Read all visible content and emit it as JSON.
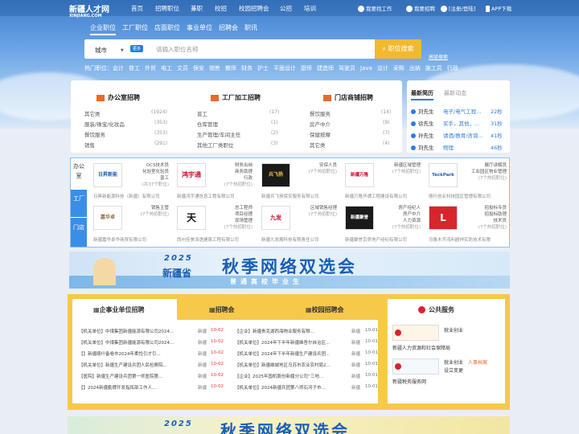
{
  "topnav": {
    "logo": "新疆人才网",
    "logo_sub": "XINJIANG.COM",
    "items": [
      "首页",
      "招聘职位",
      "兼职",
      "校招",
      "校园招聘会",
      "公招",
      "培训"
    ],
    "right": [
      "我要找工作",
      "我要招聘",
      "[注册/登陆]",
      "APP下载"
    ]
  },
  "search": {
    "tabs": [
      "企业职位",
      "工厂职位",
      "店面职位",
      "事业单位",
      "招聘会",
      "职讯"
    ],
    "city": "城市",
    "badge": "更多",
    "placeholder": "请输入职位名称",
    "button": "职位搜索",
    "advanced": "高级搜索"
  },
  "hot": {
    "label": "热门职位：",
    "items": [
      "会计",
      "普工",
      "外贸",
      "电工",
      "文员",
      "保安",
      "销售",
      "教师",
      "财务",
      "护士",
      "平面设计",
      "厨师",
      "建造师",
      "驾驶员",
      "Java",
      "设计",
      "采购",
      "出纳",
      "施工员",
      "行政"
    ]
  },
  "categories": [
    {
      "title": "办公室招聘",
      "icon": "briefcase-icon",
      "rows": [
        [
          "其它类",
          "(1924)"
        ],
        [
          "服装/珠宝/化妆品",
          "(353)"
        ],
        [
          "餐饮服务",
          "(353)"
        ],
        [
          "销售",
          "(291)"
        ]
      ]
    },
    {
      "title": "工厂加工招聘",
      "icon": "factory-icon",
      "rows": [
        [
          "普工",
          "(17)"
        ],
        [
          "仓库管理",
          "(1)"
        ],
        [
          "生产管理/车间主任",
          "(2)"
        ],
        [
          "其他工厂类职位",
          "(3)"
        ]
      ]
    },
    {
      "title": "门店商铺招聘",
      "icon": "store-icon",
      "rows": [
        [
          "餐饮服务",
          "(14)"
        ],
        [
          "房产中介",
          "(9)"
        ],
        [
          "保健按摩",
          "(7)"
        ],
        [
          "其它类",
          "(4)"
        ]
      ]
    }
  ],
  "resumes": {
    "tabs": [
      "最新简历",
      "最新动态"
    ],
    "rows": [
      [
        "刘先生",
        "电子/电气工程...",
        "22秒"
      ],
      [
        "徐先生",
        "买手，其他，...",
        "31秒"
      ],
      [
        "孙先生",
        "请酒/教育/咨询...",
        "41秒"
      ],
      [
        "刘先生",
        "物理",
        "46秒"
      ]
    ]
  },
  "companies": {
    "sidebar": [
      "办公室",
      "工厂",
      "门店"
    ],
    "items": [
      {
        "logo": "日昇新能",
        "jobs": [
          "DCS技术员",
          "化验室化验员",
          "普工"
        ],
        "more": "(共37个职位)",
        "name": "日昇新能源科技（新疆）有限公司"
      },
      {
        "logo": "鸿宇通",
        "jobs": [
          "财务出纳",
          "商务助理",
          "行政"
        ],
        "more": "(7个热招职位)",
        "name": "新疆鸿宇通信息工程有限公司"
      },
      {
        "logo": "兵飞扬",
        "jobs": [
          "安保人员"
        ],
        "more": "(7个热招职位)",
        "name": "新疆兵飞扬保安服务有限公司"
      },
      {
        "logo": "新疆万隆",
        "jobs": [
          "新疆区域管理"
        ],
        "more": "(7个热招职位)",
        "name": "新疆万隆华通工程建设有限公司"
      },
      {
        "logo": "TeckPark",
        "jobs": [
          "展厅讲解员",
          "工业园区物业管理"
        ],
        "more": "(7个热招职位)",
        "name": "喀什创业科技园区管理有限公司"
      },
      {
        "logo": "嘉华卓",
        "jobs": [
          "销售主管"
        ],
        "more": "(7个热招职位)",
        "name": "新疆嘉华卓华商贸有限公司"
      },
      {
        "logo": "天",
        "jobs": [
          "总工程师",
          "项目经理",
          "现场管理"
        ],
        "more": "(7个热招职位)",
        "name": "西州佳美泽透建筑工程有限公司"
      },
      {
        "logo": "九发",
        "jobs": [
          "区域销售经理"
        ],
        "more": "(7个热招职位)",
        "name": "新疆九发展科技有限责任公司"
      },
      {
        "logo": "新疆聚誉",
        "jobs": [
          "房产经纪人",
          "房产中介",
          "人力资源"
        ],
        "more": "(7个热招职位)",
        "name": "新疆聚誉京房地产经纪有限公司"
      },
      {
        "logo": "L",
        "jobs": [
          "招投标专员",
          "招投标助理",
          "技术员"
        ],
        "more": "(7个热招职位)",
        "name": "乌鲁木齐鸿利超祥实防技术有限"
      }
    ]
  },
  "banner": {
    "year": "2025",
    "province": "新疆省",
    "main": "秋季网络双选会",
    "sub": "普通高校毕业生"
  },
  "jobs_panel": {
    "tabs": [
      "企事业单位招聘",
      "招聘会",
      "校园招聘会"
    ],
    "left": [
      [
        "【机关单位】中煤集团新疆能源有限公司2024...",
        "新疆",
        "10-02"
      ],
      [
        "【机关单位】中煤集团新疆能源有限公司2024...",
        "新疆",
        "10-02"
      ],
      [
        "【】新疆喀什备卷市2024年柔性引才引...",
        "新疆",
        "10-02"
      ],
      [
        "【机关单位】新疆生产建设兵团人民检察院...",
        "新疆",
        "10-02"
      ],
      [
        "【医院】新疆生产建设兵团第一师医院第...",
        "新疆",
        "10-02"
      ],
      [
        "【】2024新疆勤牌开发指挥部工作人...",
        "新疆",
        "10-02"
      ]
    ],
    "right": [
      [
        "【企业】新疆贵克湖西海物业服务有限...",
        "新疆",
        "10-01"
      ],
      [
        "【机关单位】2024年下半年新疆维吾尔自治区...",
        "新疆",
        "10-01"
      ],
      [
        "【机关单位】2024年下半年新疆生产建设兵团...",
        "新疆",
        "10-01"
      ],
      [
        "【机关单位】新疆维城地区乌苏市农业农村局2...",
        "新疆",
        "10-01"
      ],
      [
        "【企业】2025年国机股份新疆分公司“三地...",
        "新疆",
        "10-01"
      ],
      [
        "【机关单位】2024新疆兵团第八师石河子市...",
        "新疆",
        "10-01"
      ]
    ]
  },
  "public_service": {
    "title": "公共服务",
    "items": [
      {
        "label": "就业创业",
        "name": "新疆人力资源和社会保障局"
      },
      {
        "label": "就业创业",
        "extra": "人事档案",
        "extra2": "设立变更",
        "name": "新疆税务服务网"
      }
    ]
  },
  "banner2": {
    "year": "2025",
    "main": "秋季网络双选会"
  },
  "colors": {
    "accent": "#2a7de1",
    "yellow": "#f3c545",
    "search_button": "#f3b92e",
    "red": "#e33333"
  }
}
